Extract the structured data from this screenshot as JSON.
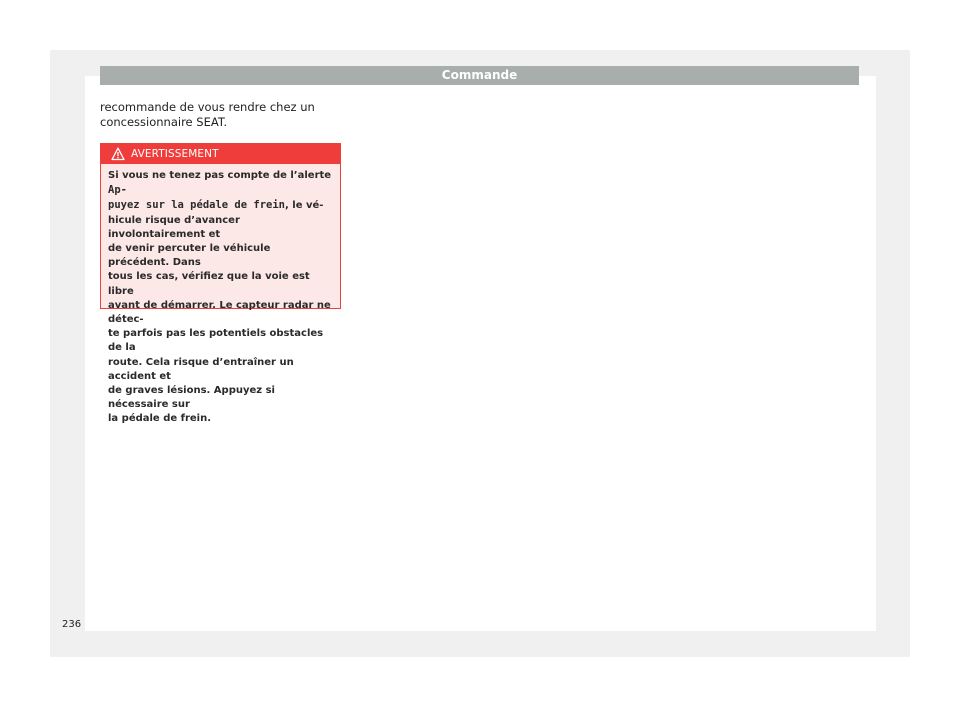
{
  "header": {
    "title": "Commande"
  },
  "intro": {
    "line1": "recommande de vous rendre chez un",
    "line2": "concessionnaire SEAT."
  },
  "warning": {
    "title": "AVERTISSEMENT",
    "icon": "warning-triangle-icon",
    "lines": [
      "Si vous ne tenez pas compte de l’alerte ",
      "Ap-",
      "puyez sur la pédale de frein",
      ", le vé-",
      "hicule risque d’avancer involontairement et",
      "de venir percuter le véhicule précédent. Dans",
      "tous les cas, vérifiez que la voie est libre",
      "avant de démarrer. Le capteur radar ne détec-",
      "te parfois pas les potentiels obstacles de la",
      "route. Cela risque d’entraîner un accident et",
      "de graves lésions. Appuyez si nécessaire sur",
      "la pédale de frein."
    ]
  },
  "page_number": "236",
  "colors": {
    "header_bar": "#a8aeac",
    "warning_red": "#ef3d3b",
    "warning_bg": "#fde8e8"
  }
}
